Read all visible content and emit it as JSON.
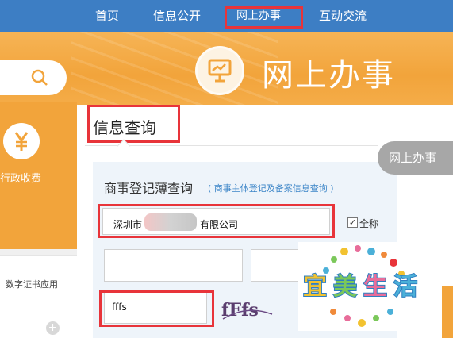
{
  "nav": {
    "items": [
      {
        "label": "首页"
      },
      {
        "label": "信息公开"
      },
      {
        "label": "网上办事"
      },
      {
        "label": "互动交流"
      }
    ],
    "active_color": "#e8343a",
    "bg_color": "#3d7ec4"
  },
  "banner": {
    "title": "网上办事",
    "icon": "presentation-chart-icon",
    "color": "#f2a43b"
  },
  "sidebar": {
    "search_icon": "search-icon",
    "fee_icon": "yen-icon",
    "fee_label": "行政收费",
    "cert_label": "数字证书应用",
    "add_icon": "plus-icon"
  },
  "main": {
    "section_title": "信息查询",
    "float_tab": "网上办事",
    "form": {
      "title": "商事登记薄查询",
      "subtitle": "( 商事主体登记及备案信息查询 )",
      "company_prefix": "深圳市",
      "company_suffix": "有限公司",
      "fullname_checked": true,
      "fullname_label": "全称",
      "captcha_input": "fffs",
      "captcha_text": "fFfs"
    }
  },
  "watermark": {
    "text_chars": [
      "宜",
      "美",
      "生",
      "活"
    ]
  }
}
